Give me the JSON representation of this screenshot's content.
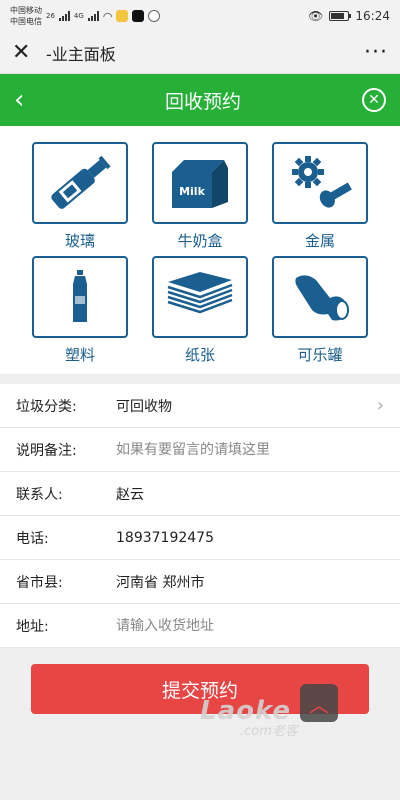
{
  "status": {
    "carrier1": "中国移动",
    "carrier2": "中国电信",
    "net1": "26",
    "net2": "4G",
    "time": "16:24",
    "battery_level": 0.8
  },
  "wechat": {
    "title": "-业主面板",
    "more": "···"
  },
  "header": {
    "title": "回收预约"
  },
  "categories": [
    {
      "label": "玻璃",
      "icon": "glass-bottle-icon"
    },
    {
      "label": "牛奶盒",
      "icon": "milk-carton-icon",
      "box_text": "Milk"
    },
    {
      "label": "金属",
      "icon": "metal-gear-screw-icon"
    },
    {
      "label": "塑料",
      "icon": "plastic-bottle-icon"
    },
    {
      "label": "纸张",
      "icon": "paper-stack-icon"
    },
    {
      "label": "可乐罐",
      "icon": "crushed-can-icon"
    }
  ],
  "form": {
    "category": {
      "label": "垃圾分类:",
      "value": "可回收物"
    },
    "remark": {
      "label": "说明备注:",
      "placeholder": "如果有要留言的请填这里"
    },
    "contact": {
      "label": "联系人:",
      "value": "赵云"
    },
    "phone": {
      "label": "电话:",
      "value": "18937192475"
    },
    "region": {
      "label": "省市县:",
      "value": "河南省 郑州市"
    },
    "address": {
      "label": "地址:",
      "placeholder": "请输入收货地址"
    }
  },
  "submit_label": "提交预约",
  "watermark": {
    "text": "Laoke",
    "sub": ".com老客"
  },
  "colors": {
    "green": "#26b037",
    "blue": "#1a5f8f",
    "red": "#e84545"
  }
}
